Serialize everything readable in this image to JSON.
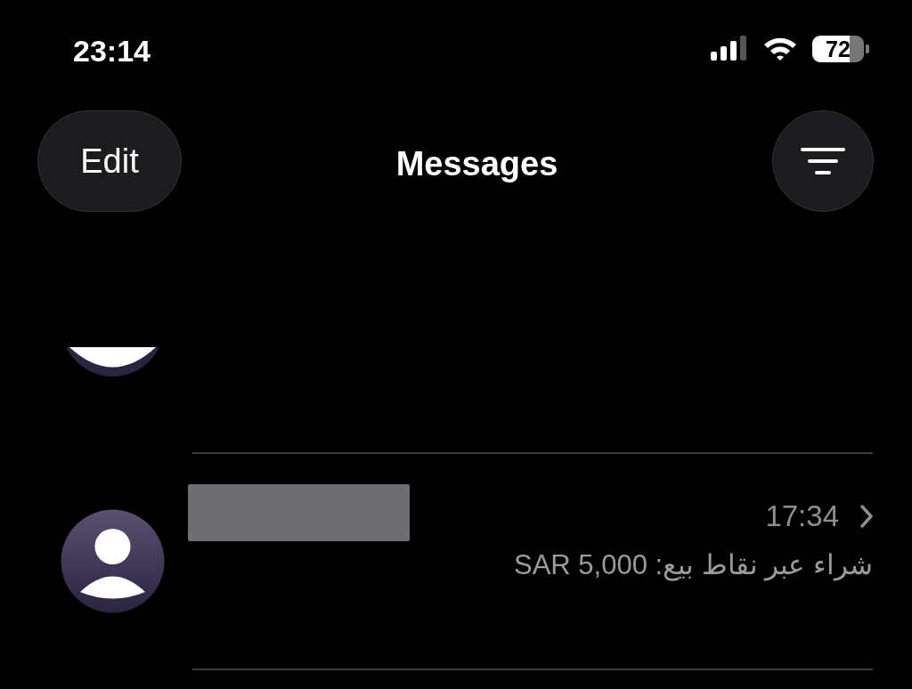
{
  "status_bar": {
    "time": "23:14",
    "battery": "72"
  },
  "header": {
    "edit_button": "Edit",
    "title": "Messages"
  },
  "conversations": [
    {
      "kind": "partial"
    },
    {
      "kind": "full",
      "name_redacted": true,
      "time": "17:34",
      "preview": "شراء عبر نقاط بيع: SAR 5,000"
    }
  ]
}
